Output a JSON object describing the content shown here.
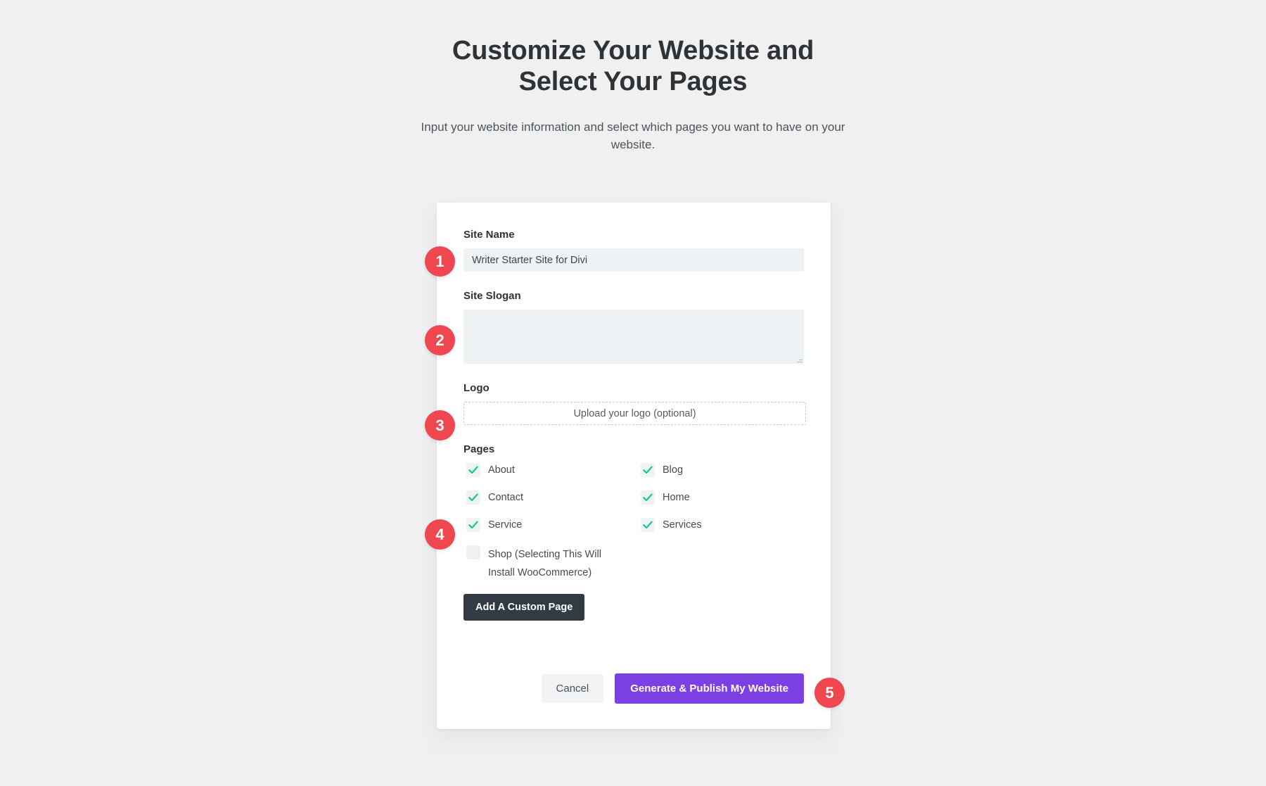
{
  "header": {
    "title_line1": "Customize Your Website and",
    "title_line2": "Select Your Pages",
    "subtitle": "Input your website information and select which pages you want to have on your website."
  },
  "form": {
    "site_name": {
      "label": "Site Name",
      "value": "Writer Starter Site for Divi",
      "placeholder": ""
    },
    "site_slogan": {
      "label": "Site Slogan",
      "value": "",
      "placeholder": ""
    },
    "logo": {
      "label": "Logo",
      "upload_label": "Upload your logo (optional)"
    },
    "pages": {
      "label": "Pages",
      "items": [
        {
          "label": "About",
          "checked": true
        },
        {
          "label": "Blog",
          "checked": true
        },
        {
          "label": "Contact",
          "checked": true
        },
        {
          "label": "Home",
          "checked": true
        },
        {
          "label": "Service",
          "checked": true
        },
        {
          "label": "Services",
          "checked": true
        }
      ],
      "shop": {
        "label": "Shop (Selecting This Will Install WooCommerce)",
        "checked": false
      },
      "add_custom_page_label": "Add A Custom Page"
    }
  },
  "actions": {
    "cancel_label": "Cancel",
    "primary_label": "Generate & Publish My Website"
  },
  "badges": [
    {
      "number": "1"
    },
    {
      "number": "2"
    },
    {
      "number": "3"
    },
    {
      "number": "4"
    },
    {
      "number": "5"
    }
  ],
  "colors": {
    "page_background": "#f0f0f1",
    "card_background": "#ffffff",
    "badge_red": "#ef4750",
    "primary_purple": "#7b3fe4",
    "dark_button": "#323a44",
    "check_teal": "#1fc39a",
    "input_background": "#eff2f5"
  }
}
